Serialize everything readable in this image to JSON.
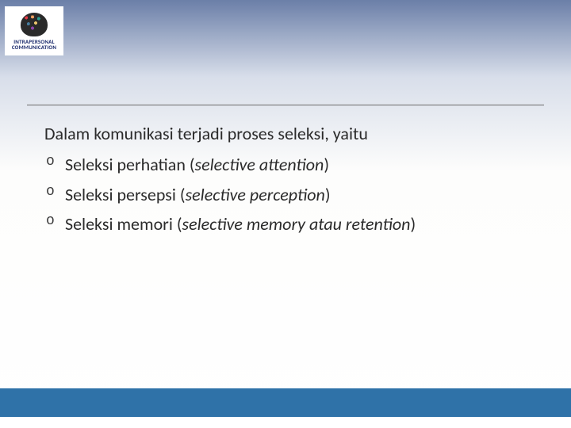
{
  "logo": {
    "caption_line1": "INTRAPERSONAL",
    "caption_line2": "COMMUNICATION"
  },
  "content": {
    "intro": "Dalam komunikasi terjadi proses seleksi, yaitu",
    "items": [
      {
        "text": "Seleksi perhatian (",
        "italic": "selective attention",
        "after": ")"
      },
      {
        "text": "Seleksi persepsi (",
        "italic": "selective perception",
        "after": ")"
      },
      {
        "text": "Seleksi memori (",
        "italic": "selective memory atau retention",
        "after": ")"
      }
    ]
  }
}
